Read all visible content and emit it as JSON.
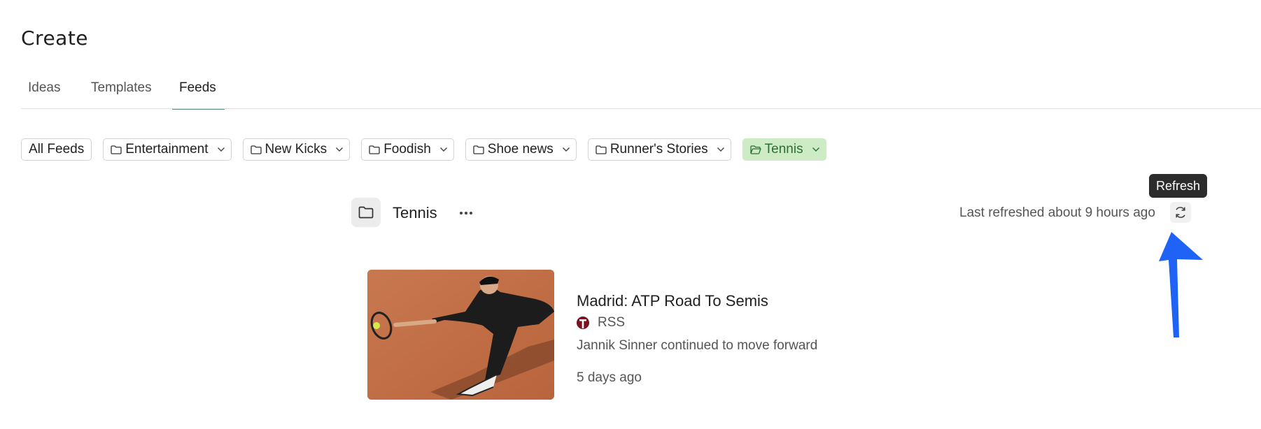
{
  "page": {
    "title": "Create"
  },
  "tabs": [
    {
      "label": "Ideas"
    },
    {
      "label": "Templates"
    },
    {
      "label": "Feeds"
    }
  ],
  "filters": [
    {
      "label": "All Feeds"
    },
    {
      "label": "Entertainment"
    },
    {
      "label": "New Kicks"
    },
    {
      "label": "Foodish"
    },
    {
      "label": "Shoe news"
    },
    {
      "label": "Runner's Stories"
    },
    {
      "label": "Tennis"
    }
  ],
  "feed": {
    "name": "Tennis",
    "last_refreshed": "Last refreshed about 9 hours ago",
    "tooltip": "Refresh"
  },
  "article": {
    "title": "Madrid: ATP Road To Semis",
    "source": "RSS",
    "summary": "Jannik Sinner continued to move forward",
    "time": "5 days ago"
  },
  "colors": {
    "accent_underline": "#5a8f7a",
    "active_chip_bg": "#cdebc4",
    "active_chip_text": "#2d6e36",
    "annotation_arrow": "#1e63f5"
  }
}
